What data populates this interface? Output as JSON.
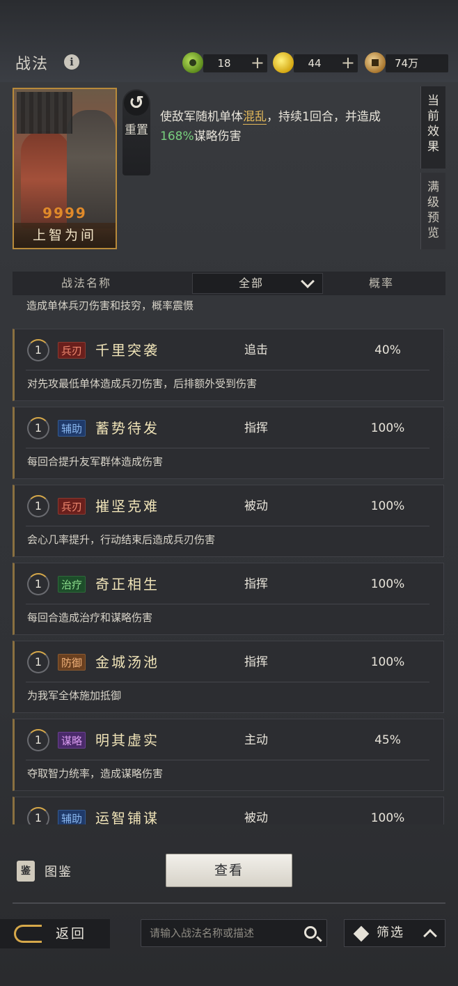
{
  "header": {
    "title": "战法",
    "info_icon": "info-icon"
  },
  "resources": [
    {
      "name": "jade",
      "icon": "jade-coin-icon",
      "value": "18",
      "has_plus": true
    },
    {
      "name": "gold",
      "icon": "gold-coin-icon",
      "value": "44",
      "has_plus": true
    },
    {
      "name": "copper",
      "icon": "copper-coin-icon",
      "value": "74万",
      "has_plus": false
    }
  ],
  "plus_glyph": "+",
  "card": {
    "name": "上智为间",
    "stars": "9999"
  },
  "reset": {
    "label": "重置"
  },
  "effect": {
    "part1": "使敌军随机单体",
    "keyword": "混乱",
    "part2": "，持续1回合，并造成",
    "percent": "168%",
    "part3": "谋略伤害"
  },
  "side_tabs": {
    "current": "当前效果",
    "max_preview": "满级预览"
  },
  "table": {
    "col_name": "战法名称",
    "filter_selected": "全部",
    "col_rate": "概率",
    "partial_desc": "造成单体兵刃伤害和技穷，概率震慑",
    "items": [
      {
        "level": "1",
        "tag": "兵刃",
        "tag_color": "#6a1f1c",
        "name": "千里突袭",
        "type": "追击",
        "rate": "40%",
        "desc": "对先攻最低单体造成兵刃伤害，后排额外受到伤害"
      },
      {
        "level": "1",
        "tag": "辅助",
        "tag_color": "#1f3a6a",
        "name": "蓄势待发",
        "type": "指挥",
        "rate": "100%",
        "desc": "每回合提升友军群体造成伤害"
      },
      {
        "level": "1",
        "tag": "兵刃",
        "tag_color": "#6a1f1c",
        "name": "摧坚克难",
        "type": "被动",
        "rate": "100%",
        "desc": "会心几率提升，行动结束后造成兵刃伤害"
      },
      {
        "level": "1",
        "tag": "治疗",
        "tag_color": "#1d4d2a",
        "name": "奇正相生",
        "type": "指挥",
        "rate": "100%",
        "desc": "每回合造成治疗和谋略伤害"
      },
      {
        "level": "1",
        "tag": "防御",
        "tag_color": "#6a4020",
        "name": "金城汤池",
        "type": "指挥",
        "rate": "100%",
        "desc": "为我军全体施加抵御"
      },
      {
        "level": "1",
        "tag": "谋略",
        "tag_color": "#4a2a6a",
        "name": "明其虚实",
        "type": "主动",
        "rate": "45%",
        "desc": "夺取智力统率，造成谋略伤害"
      },
      {
        "level": "1",
        "tag": "辅助",
        "tag_color": "#1f3a6a",
        "name": "运智铺谋",
        "type": "被动",
        "rate": "100%",
        "desc": ""
      }
    ]
  },
  "bottom": {
    "atlas_icon_char": "鉴",
    "atlas_label": "图鉴",
    "view_button": "查看",
    "back_label": "返回",
    "search_placeholder": "请输入战法名称或描述",
    "filter_label": "筛选"
  }
}
